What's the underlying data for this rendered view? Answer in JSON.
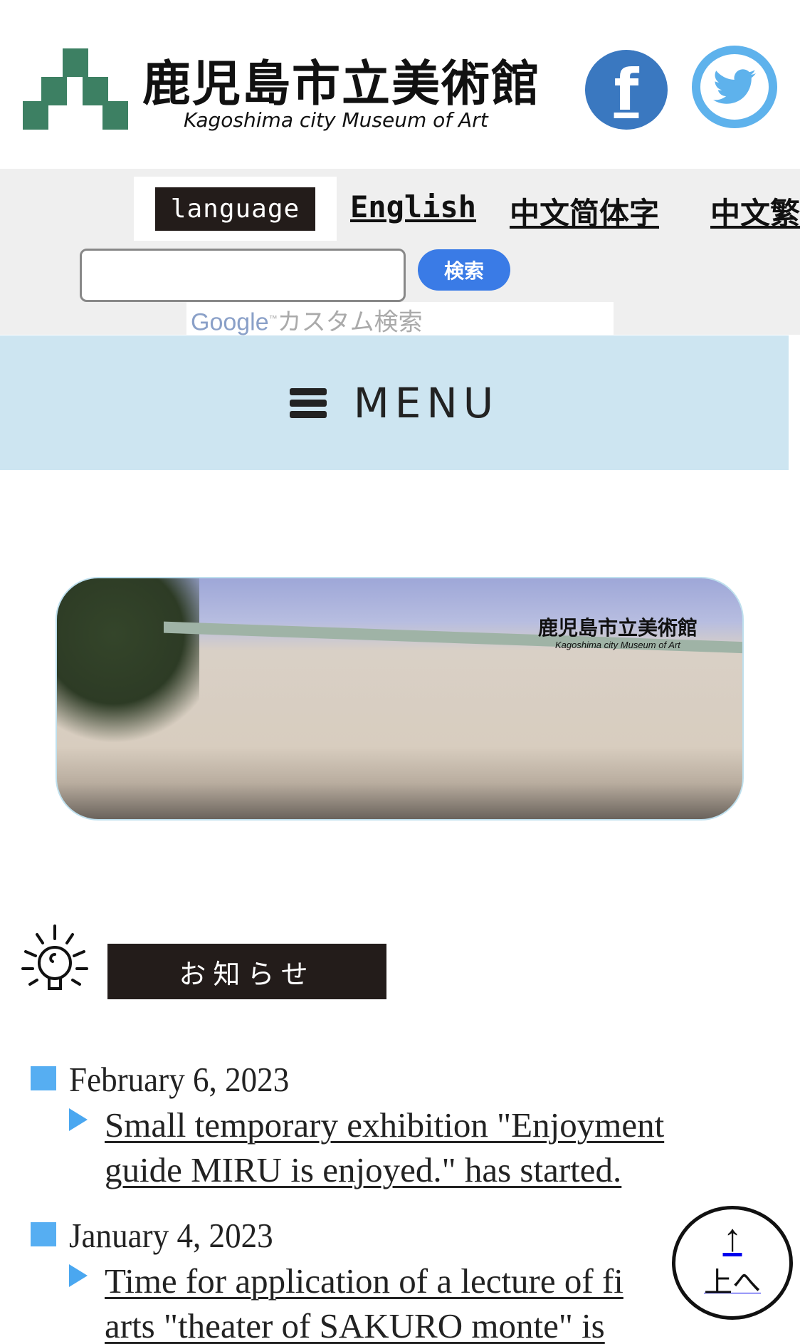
{
  "header": {
    "title_jp": "鹿児島市立美術館",
    "title_en": "Kagoshima city Museum of Art",
    "logo_color": "#3d8063",
    "social": [
      {
        "name": "facebook",
        "icon": "facebook-icon",
        "glyph": "f",
        "color": "#3a78c0"
      },
      {
        "name": "twitter",
        "icon": "twitter-icon",
        "color": "#5eb2ec"
      }
    ]
  },
  "language": {
    "label": "language",
    "options": [
      "English",
      "中文简体字",
      "中文繁"
    ]
  },
  "search": {
    "value": "",
    "placeholder": "",
    "button": "検索",
    "google_brand": "Google",
    "google_label": "カスタム検索",
    "button_color": "#3a7be6"
  },
  "menu": {
    "label": "MENU",
    "icon": "hamburger-icon",
    "bg_color": "#cde5f1"
  },
  "banner": {
    "title": "鹿児島市立美術館",
    "subtitle": "Kagoshima city Museum of Art"
  },
  "notices": {
    "heading": "お知らせ",
    "items": [
      {
        "date": "February 6, 2023",
        "lines": [
          "Small temporary exhibition \"Enjoyment",
          "guide MIRU is enjoyed.\" has started."
        ]
      },
      {
        "date": "January 4, 2023",
        "lines": [
          "Time for application of a lecture of fi",
          "arts \"theater of SAKURO monte\" is"
        ]
      }
    ]
  },
  "back_to_top": {
    "arrow": "↑",
    "label": "上へ"
  }
}
